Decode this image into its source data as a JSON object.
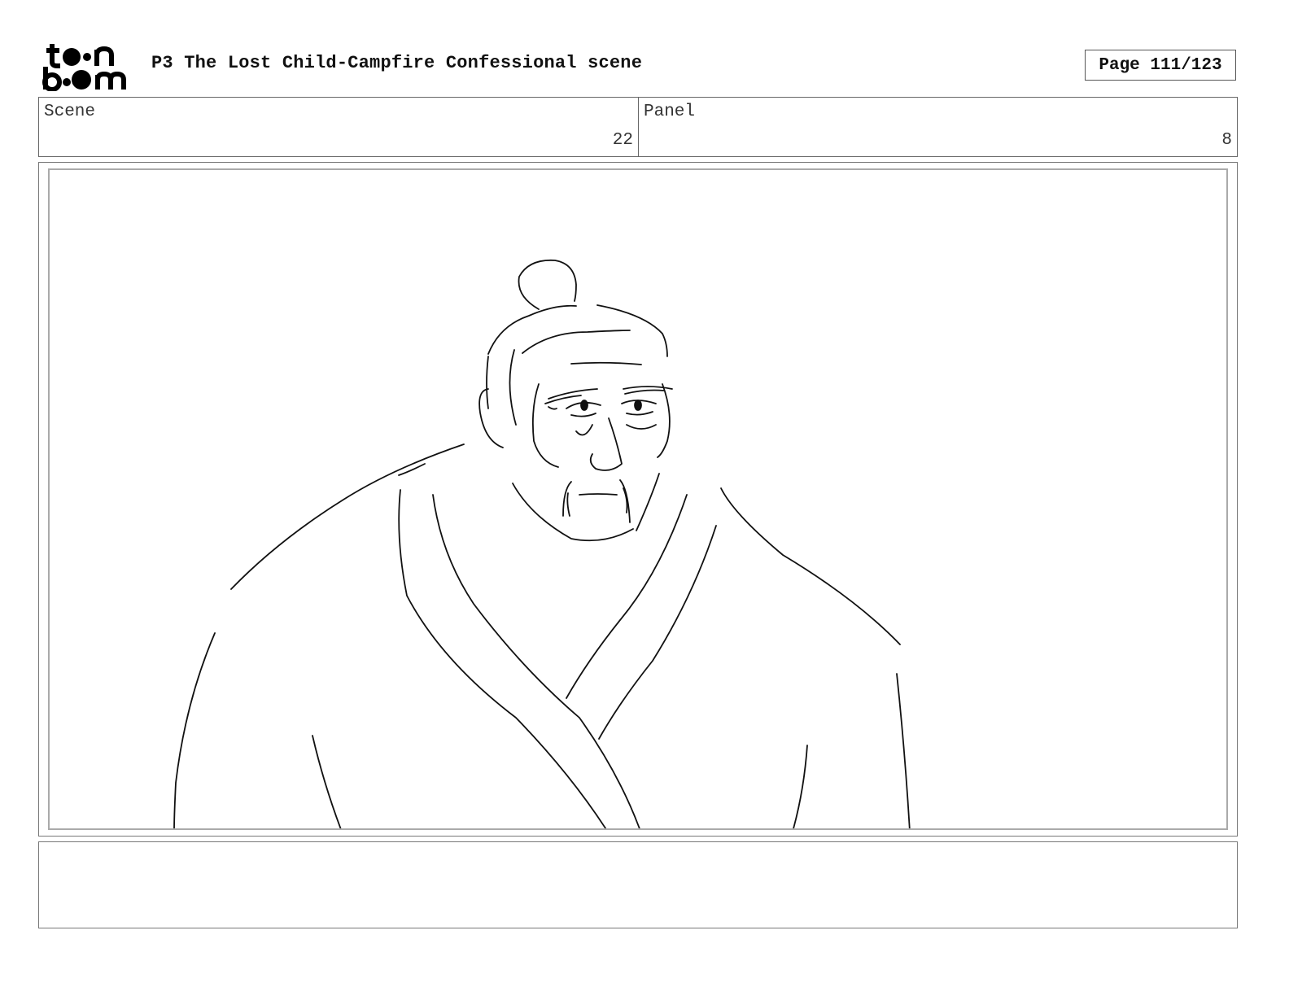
{
  "header": {
    "logo_text_line1": "toon",
    "logo_text_line2": "boom",
    "title": "P3 The Lost Child-Campfire Confessional scene",
    "page": "Page 111/123"
  },
  "scene": {
    "label": "Scene",
    "value": "22"
  },
  "panel": {
    "label": "Panel",
    "value": "8"
  },
  "notes": {
    "text": ""
  }
}
